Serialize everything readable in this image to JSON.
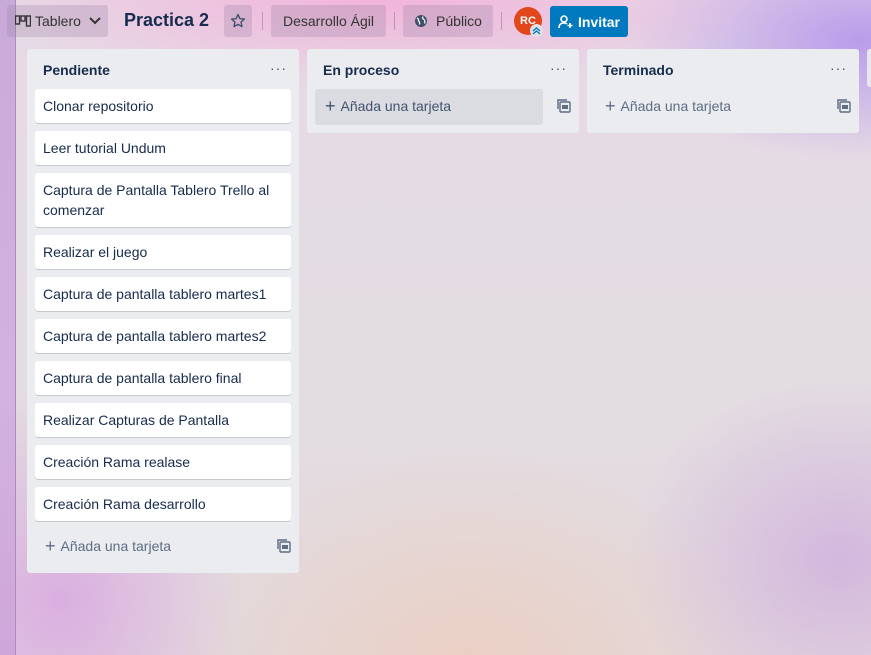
{
  "header": {
    "view_switch_label": "Tablero",
    "board_title": "Practica 2",
    "workspace_label": "Desarrollo Ágil",
    "visibility_label": "Público",
    "avatar_initials": "RC",
    "invite_label": "Invitar",
    "accent_color": "#0079bf",
    "avatar_color": "#e2471b"
  },
  "lists": [
    {
      "title": "Pendiente",
      "menu": "···",
      "cards": [
        "Clonar repositorio",
        "Leer tutorial Undum",
        "Captura de Pantalla Tablero Trello al comenzar",
        "Realizar el juego",
        "Captura de pantalla tablero martes1",
        "Captura de pantalla tablero martes2",
        "Captura de pantalla tablero final",
        "Realizar Capturas de Pantalla",
        "Creación Rama realase",
        "Creación Rama desarrollo"
      ],
      "add_label": "Añada una tarjeta"
    },
    {
      "title": "En proceso",
      "menu": "···",
      "cards": [],
      "add_label": "Añada una tarjeta"
    },
    {
      "title": "Terminado",
      "menu": "···",
      "cards": [],
      "add_label": "Añada una tarjeta"
    }
  ],
  "icons": {
    "board": "board-icon",
    "chevron": "chevron-down-icon",
    "star": "star-icon",
    "globe": "globe-icon",
    "add_member": "add-member-icon",
    "plus": "plus-icon",
    "template": "card-template-icon"
  }
}
